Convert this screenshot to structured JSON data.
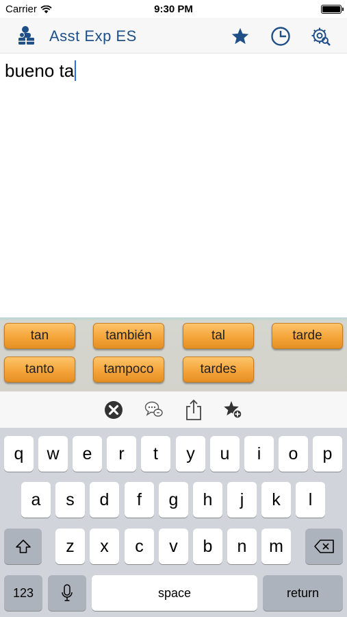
{
  "status_bar": {
    "carrier": "Carrier",
    "time": "9:30 PM"
  },
  "nav": {
    "title": "Asst Exp ES",
    "logo_icon": "people-icon",
    "favorites_icon": "star-icon",
    "history_icon": "clock-icon",
    "settings_icon": "gear-search-icon"
  },
  "editor": {
    "text": "bueno ta"
  },
  "suggestions": [
    "tan",
    "también",
    "tal",
    "tarde",
    "tanto",
    "tampoco",
    "tardes"
  ],
  "actions": {
    "clear_icon": "clear-x-icon",
    "speak_icon": "speech-bubbles-icon",
    "share_icon": "share-icon",
    "add_favorite_icon": "star-plus-icon"
  },
  "keyboard": {
    "row1": [
      "q",
      "w",
      "e",
      "r",
      "t",
      "y",
      "u",
      "i",
      "o",
      "p"
    ],
    "row2": [
      "a",
      "s",
      "d",
      "f",
      "g",
      "h",
      "j",
      "k",
      "l"
    ],
    "row3": [
      "z",
      "x",
      "c",
      "v",
      "b",
      "n",
      "m"
    ],
    "numbers_key": "123",
    "space_key": "space",
    "return_key": "return",
    "shift_icon": "shift-icon",
    "delete_icon": "backspace-icon",
    "mic_icon": "microphone-icon"
  },
  "colors": {
    "accent": "#1e4f87",
    "suggestion": "#f5a53a",
    "caret": "#2a6fe8",
    "keyboard_bg": "#d1d5db"
  }
}
